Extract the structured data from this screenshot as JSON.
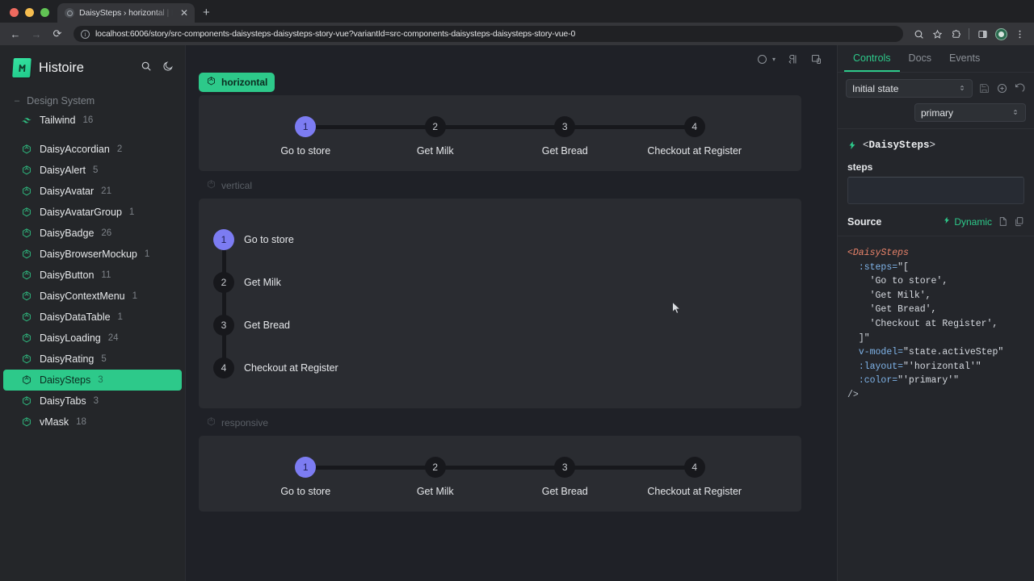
{
  "browser": {
    "tab_title": "DaisySteps › horizontal | Hist",
    "tab_close": "✕",
    "new_tab": "+",
    "back": "←",
    "forward": "→",
    "reload": "⟳",
    "url": "localhost:6006/story/src-components-daisysteps-daisysteps-story-vue?variantId=src-components-daisysteps-daisysteps-story-vue-0",
    "info_glyph": "ⓘ"
  },
  "sidebar": {
    "brand": "Histoire",
    "group_label": "Design System",
    "group_caret": "–",
    "items": [
      {
        "label": "Tailwind",
        "count": "16",
        "icon": "wind-icon",
        "active": false,
        "spaced": false
      },
      {
        "label": "DaisyAccordian",
        "count": "2",
        "icon": "cube-icon",
        "active": false,
        "spaced": true
      },
      {
        "label": "DaisyAlert",
        "count": "5",
        "icon": "cube-icon",
        "active": false,
        "spaced": false
      },
      {
        "label": "DaisyAvatar",
        "count": "21",
        "icon": "cube-icon",
        "active": false,
        "spaced": false
      },
      {
        "label": "DaisyAvatarGroup",
        "count": "1",
        "icon": "cube-icon",
        "active": false,
        "spaced": false
      },
      {
        "label": "DaisyBadge",
        "count": "26",
        "icon": "cube-icon",
        "active": false,
        "spaced": false
      },
      {
        "label": "DaisyBrowserMockup",
        "count": "1",
        "icon": "cube-icon",
        "active": false,
        "spaced": false
      },
      {
        "label": "DaisyButton",
        "count": "11",
        "icon": "cube-icon",
        "active": false,
        "spaced": false
      },
      {
        "label": "DaisyContextMenu",
        "count": "1",
        "icon": "cube-icon",
        "active": false,
        "spaced": false
      },
      {
        "label": "DaisyDataTable",
        "count": "1",
        "icon": "cube-icon",
        "active": false,
        "spaced": false
      },
      {
        "label": "DaisyLoading",
        "count": "24",
        "icon": "cube-icon",
        "active": false,
        "spaced": false
      },
      {
        "label": "DaisyRating",
        "count": "5",
        "icon": "cube-icon",
        "active": false,
        "spaced": false
      },
      {
        "label": "DaisySteps",
        "count": "3",
        "icon": "cube-icon",
        "active": true,
        "spaced": false
      },
      {
        "label": "DaisyTabs",
        "count": "3",
        "icon": "cube-icon",
        "active": false,
        "spaced": false
      },
      {
        "label": "vMask",
        "count": "18",
        "icon": "cube-icon",
        "active": false,
        "spaced": false
      }
    ]
  },
  "canvas": {
    "toolbar": {
      "color_caret": "▾"
    },
    "variants": [
      {
        "label": "horizontal",
        "active": true,
        "layout": "horizontal",
        "steps": [
          {
            "number": "1",
            "caption": "Go to store",
            "active": true
          },
          {
            "number": "2",
            "caption": "Get Milk",
            "active": false
          },
          {
            "number": "3",
            "caption": "Get Bread",
            "active": false
          },
          {
            "number": "4",
            "caption": "Checkout at Register",
            "active": false
          }
        ]
      },
      {
        "label": "vertical",
        "active": false,
        "layout": "vertical",
        "steps": [
          {
            "number": "1",
            "caption": "Go to store",
            "active": true
          },
          {
            "number": "2",
            "caption": "Get Milk",
            "active": false
          },
          {
            "number": "3",
            "caption": "Get Bread",
            "active": false
          },
          {
            "number": "4",
            "caption": "Checkout at Register",
            "active": false
          }
        ]
      },
      {
        "label": "responsive",
        "active": false,
        "layout": "horizontal",
        "steps": [
          {
            "number": "1",
            "caption": "Go to store",
            "active": true
          },
          {
            "number": "2",
            "caption": "Get Milk",
            "active": false
          },
          {
            "number": "3",
            "caption": "Get Bread",
            "active": false
          },
          {
            "number": "4",
            "caption": "Checkout at Register",
            "active": false
          }
        ]
      }
    ]
  },
  "panel": {
    "tabs": [
      {
        "label": "Controls",
        "active": true
      },
      {
        "label": "Docs",
        "active": false
      },
      {
        "label": "Events",
        "active": false
      }
    ],
    "state_select": {
      "value": "Initial state",
      "caret": "⌃⌄"
    },
    "color_select": {
      "value": "primary",
      "caret": "⌃⌄"
    },
    "component_name": "DaisySteps",
    "component_open": "<",
    "component_close": ">",
    "prop_label": "steps",
    "prop_value": "",
    "source_title": "Source",
    "dynamic_label": "Dynamic",
    "code": {
      "tag_open": "<DaisySteps",
      "lines": [
        {
          "attr": ":steps=",
          "rest": "\"["
        },
        {
          "attr": "",
          "rest": "'Go to store',"
        },
        {
          "attr": "",
          "rest": "'Get Milk',"
        },
        {
          "attr": "",
          "rest": "'Get Bread',"
        },
        {
          "attr": "",
          "rest": "'Checkout at Register',"
        },
        {
          "attr": "",
          "rest": "]\""
        },
        {
          "attr": "v-model=",
          "rest": "\"state.activeStep\""
        },
        {
          "attr": ":layout=",
          "rest": "\"'horizontal'\""
        },
        {
          "attr": ":color=",
          "rest": "\"'primary'\""
        }
      ],
      "tag_close": "/>"
    }
  },
  "colors": {
    "accent_green": "#2dc98a",
    "active_step_purple": "#7c7cf2",
    "panel_bg": "#24262b",
    "stage_bg": "#2a2c31"
  }
}
